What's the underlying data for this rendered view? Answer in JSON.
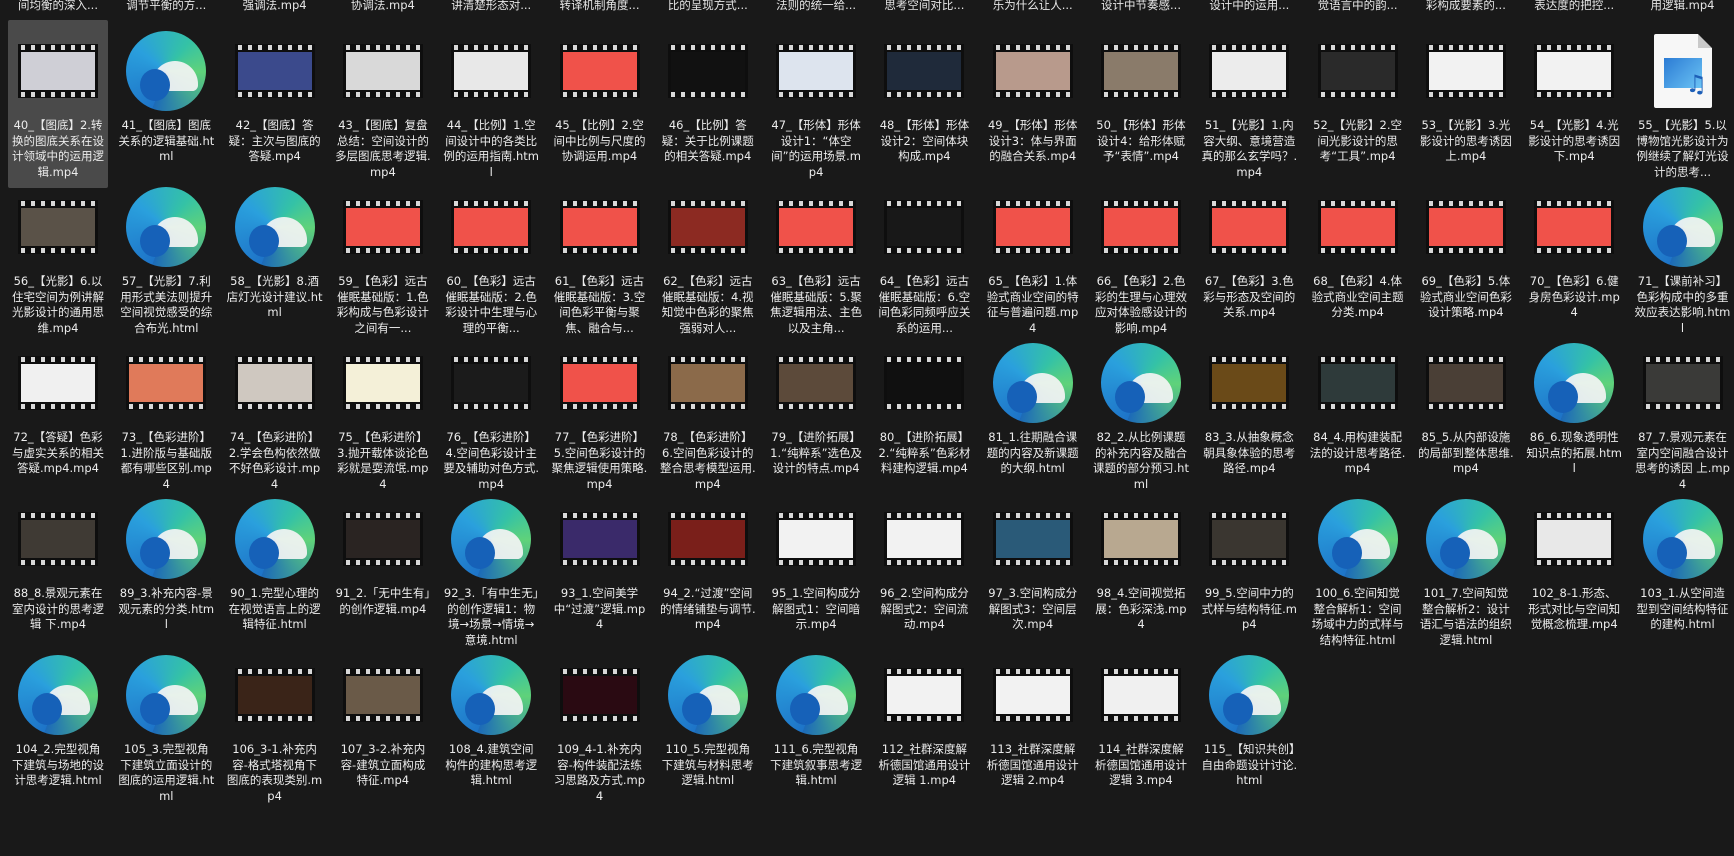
{
  "top_row": [
    "间均衡的深入...",
    "调节平衡的方...",
    "强调法.mp4",
    "协调法.mp4",
    "讲清楚形态对...",
    "转译机制角度...",
    "比的呈现方式...",
    "法则的统一给...",
    "思考空间对比...",
    "乐为什么让人...",
    "设计中节奏感...",
    "设计中的运用...",
    "觉语言中的韵...",
    "彩构成要素的...",
    "表达度的把控...",
    "用逻辑.mp4"
  ],
  "files": [
    {
      "label": "40_【图底】2.转换的图底关系在设计领域中的运用逻辑.mp4",
      "type": "video",
      "thumb": "#cfcfd6",
      "selected": true
    },
    {
      "label": "41_【图底】图底关系的逻辑基础.html",
      "type": "html",
      "thumb": ""
    },
    {
      "label": "42_【图底】答疑：主次与图底的答疑.mp4",
      "type": "video",
      "thumb": "#3b4a8c"
    },
    {
      "label": "43_【图底】复盘总结：空间设计的多层图底思考逻辑.mp4",
      "type": "video",
      "thumb": "#d9d9d9"
    },
    {
      "label": "44_【比例】1.空间设计中的各类比例的运用指南.html",
      "type": "video",
      "thumb": "#e8e8e8"
    },
    {
      "label": "45_【比例】2.空间中比例与尺度的协调运用.mp4",
      "type": "video",
      "thumb": "#f0524a"
    },
    {
      "label": "46_【比例】答疑：关于比例课题的相关答疑.mp4",
      "type": "video",
      "thumb": "#111111"
    },
    {
      "label": "47_【形体】形体设计1：“体空间”的运用场景.mp4",
      "type": "video",
      "thumb": "#dde4ee"
    },
    {
      "label": "48_【形体】形体设计2：空间体块构成.mp4",
      "type": "video",
      "thumb": "#1f2a3a"
    },
    {
      "label": "49_【形体】形体设计3：体与界面的融合关系.mp4",
      "type": "video",
      "thumb": "#b89a8c"
    },
    {
      "label": "50_【形体】形体设计4：给形体赋予“表情”.mp4",
      "type": "video",
      "thumb": "#8a7b6a"
    },
    {
      "label": "51_【光影】1.内容大纲、意境营造真的那么玄学吗？.mp4",
      "type": "video",
      "thumb": "#ececec"
    },
    {
      "label": "52_【光影】2.空间光影设计的思考“工具”.mp4",
      "type": "video",
      "thumb": "#2a2a2a"
    },
    {
      "label": "53_【光影】3.光影设计的思考诱因 上.mp4",
      "type": "video",
      "thumb": "#f2f2f2"
    },
    {
      "label": "54_【光影】4.光影设计的思考诱因 下.mp4",
      "type": "video",
      "thumb": "#f2f2f2"
    },
    {
      "label": "55_【光影】5.以博物馆光影设计为例继续了解灯光设计的思考...",
      "type": "doc",
      "thumb": ""
    },
    {
      "label": "56_【光影】6.以住宅空间为例讲解光影设计的通用思维.mp4",
      "type": "video",
      "thumb": "#5a5248"
    },
    {
      "label": "57_【光影】7.利用形式美法则提升空间视觉感受的综合布光.html",
      "type": "html",
      "thumb": ""
    },
    {
      "label": "58_【光影】8.酒店灯光设计建议.html",
      "type": "html",
      "thumb": ""
    },
    {
      "label": "59_【色彩】远古催眠基础版：1.色彩构成与色彩设计之间有一...",
      "type": "video",
      "thumb": "#f0524a"
    },
    {
      "label": "60_【色彩】远古催眠基础版：2.色彩设计中生理与心理的平衡...",
      "type": "video",
      "thumb": "#f0524a"
    },
    {
      "label": "61_【色彩】远古催眠基础版：3.空间色彩平衡与聚焦、融合与...",
      "type": "video",
      "thumb": "#f0524a"
    },
    {
      "label": "62_【色彩】远古催眠基础版：4.视知觉中色彩的聚焦强弱对人...",
      "type": "video",
      "thumb": "#8c2a22"
    },
    {
      "label": "63_【色彩】远古催眠基础版：5.聚焦逻辑用法、主色以及主角...",
      "type": "video",
      "thumb": "#f0524a"
    },
    {
      "label": "64_【色彩】远古催眠基础版：6.空间色彩同频呼应关系的运用...",
      "type": "video",
      "thumb": "#181818"
    },
    {
      "label": "65_【色彩】1.体验式商业空间的特征与普遍问题.mp4",
      "type": "video",
      "thumb": "#f0524a"
    },
    {
      "label": "66_【色彩】2.色彩的生理与心理效应对体验感设计的影响.mp4",
      "type": "video",
      "thumb": "#f0524a"
    },
    {
      "label": "67_【色彩】3.色彩与形态及空间的关系.mp4",
      "type": "video",
      "thumb": "#f0524a"
    },
    {
      "label": "68_【色彩】4.体验式商业空间主题分类.mp4",
      "type": "video",
      "thumb": "#f0524a"
    },
    {
      "label": "69_【色彩】5.体验式商业空间色彩设计策略.mp4",
      "type": "video",
      "thumb": "#f0524a"
    },
    {
      "label": "70_【色彩】6.健身房色彩设计.mp4",
      "type": "video",
      "thumb": "#f0524a"
    },
    {
      "label": "71_【课前补习】色彩构成中的多重效应表达影响.html",
      "type": "html",
      "thumb": ""
    },
    {
      "label": "72_【答疑】色彩与虚实关系的相关答疑.mp4.mp4",
      "type": "video",
      "thumb": "#f0f0f0"
    },
    {
      "label": "73_【色彩进阶】1.进阶版与基础版都有哪些区别.mp4",
      "type": "video",
      "thumb": "#e07a5a"
    },
    {
      "label": "74_【色彩进阶】2.学会色构依然做不好色彩设计.mp4",
      "type": "video",
      "thumb": "#cfc8c0"
    },
    {
      "label": "75_【色彩进阶】3.抛开载体谈论色彩就是耍流氓.mp4",
      "type": "video",
      "thumb": "#f4f0d8"
    },
    {
      "label": "76_【色彩进阶】4.空间色彩设计主要及辅助对色方式.mp4",
      "type": "video",
      "thumb": "#1b1b1b"
    },
    {
      "label": "77_【色彩进阶】5.空间色彩设计的聚焦逻辑使用策略.mp4",
      "type": "video",
      "thumb": "#f0524a"
    },
    {
      "label": "78_【色彩进阶】6.空间色彩设计的整合思考模型运用.mp4",
      "type": "video",
      "thumb": "#8b6a4a"
    },
    {
      "label": "79_【进阶拓展】1.“纯粹系”选色及设计的特点.mp4",
      "type": "video",
      "thumb": "#5c4a3a"
    },
    {
      "label": "80_【进阶拓展】2.“纯粹系”色彩材料建构逻辑.mp4",
      "type": "video",
      "thumb": "#101010"
    },
    {
      "label": "81_1.往期融合课题的内容及新课题的大纲.html",
      "type": "html",
      "thumb": ""
    },
    {
      "label": "82_2.从比例课题的补充内容及融合课题的部分预习.html",
      "type": "html",
      "thumb": ""
    },
    {
      "label": "83_3.从抽象概念朝具象体验的思考路径.mp4",
      "type": "video",
      "thumb": "#6a4a18"
    },
    {
      "label": "84_4.用构建装配法的设计思考路径.mp4",
      "type": "video",
      "thumb": "#2e3a3a"
    },
    {
      "label": "85_5.从内部设施的局部到整体思维.mp4",
      "type": "video",
      "thumb": "#4a3f36"
    },
    {
      "label": "86_6.现象透明性知识点的拓展.html",
      "type": "html",
      "thumb": ""
    },
    {
      "label": "87_7.景观元素在室内空间融合设计思考的诱因 上.mp4",
      "type": "video",
      "thumb": "#3a3a38"
    },
    {
      "label": "88_8.景观元素在室内设计的思考逻辑 下.mp4",
      "type": "video",
      "thumb": "#3f3a34"
    },
    {
      "label": "89_3.补充内容-景观元素的分类.html",
      "type": "html",
      "thumb": ""
    },
    {
      "label": "90_1.完型心理的在视觉语言上的逻辑特征.html",
      "type": "html",
      "thumb": ""
    },
    {
      "label": "91_2.「无中生有」的创作逻辑.mp4",
      "type": "video",
      "thumb": "#2a2422"
    },
    {
      "label": "92_3.「有中生无」的创作逻辑1：物境→场景→情境→意境.html",
      "type": "html",
      "thumb": ""
    },
    {
      "label": "93_1.空间美学中“过渡”逻辑.mp4",
      "type": "video",
      "thumb": "#3a2a6a"
    },
    {
      "label": "94_2.“过渡”空间的情绪铺垫与调节.mp4",
      "type": "video",
      "thumb": "#7a1f1a"
    },
    {
      "label": "95_1.空间构成分解图式1：空间暗示.mp4",
      "type": "video",
      "thumb": "#f2f2f2"
    },
    {
      "label": "96_2.空间构成分解图式2：空间流动.mp4",
      "type": "video",
      "thumb": "#f2f2f2"
    },
    {
      "label": "97_3.空间构成分解图式3：空间层次.mp4",
      "type": "video",
      "thumb": "#2a5a78"
    },
    {
      "label": "98_4.空间视觉拓展：色彩深浅.mp4",
      "type": "video",
      "thumb": "#b8a890"
    },
    {
      "label": "99_5.空间中力的式样与结构特征.mp4",
      "type": "video",
      "thumb": "#3a3630"
    },
    {
      "label": "100_6.空间知觉整合解析1：空间场域中力的式样与结构特征.html",
      "type": "html",
      "thumb": ""
    },
    {
      "label": "101_7.空间知觉整合解析2：设计语汇与语法的组织逻辑.html",
      "type": "html",
      "thumb": ""
    },
    {
      "label": "102_8-1.形态、形式对比与空间知觉概念梳理.mp4",
      "type": "video",
      "thumb": "#e8e8e8"
    },
    {
      "label": "103_1.从空间造型到空间结构特征的建构.html",
      "type": "html",
      "thumb": ""
    },
    {
      "label": "104_2.完型视角下建筑与场地的设计思考逻辑.html",
      "type": "html",
      "thumb": ""
    },
    {
      "label": "105_3.完型视角下建筑立面设计的图底的运用逻辑.html",
      "type": "html",
      "thumb": ""
    },
    {
      "label": "106_3-1.补充内容-格式塔视角下图底的表现类别.mp4",
      "type": "video",
      "thumb": "#3a2418"
    },
    {
      "label": "107_3-2.补充内容-建筑立面构成特征.mp4",
      "type": "video",
      "thumb": "#6a5a48"
    },
    {
      "label": "108_4.建筑空间构件的建构思考逻辑.html",
      "type": "html",
      "thumb": ""
    },
    {
      "label": "109_4-1.补充内容-构件装配法练习思路及方式.mp4",
      "type": "video",
      "thumb": "#2a0a12"
    },
    {
      "label": "110_5.完型视角下建筑与材料思考逻辑.html",
      "type": "html",
      "thumb": ""
    },
    {
      "label": "111_6.完型视角下建筑叙事思考逻辑.html",
      "type": "html",
      "thumb": ""
    },
    {
      "label": "112_社群深度解析德国馆通用设计逻辑 1.mp4",
      "type": "video",
      "thumb": "#f2f2f2"
    },
    {
      "label": "113_社群深度解析德国馆通用设计逻辑 2.mp4",
      "type": "video",
      "thumb": "#f2f2f2"
    },
    {
      "label": "114_社群深度解析德国馆通用设计逻辑 3.mp4",
      "type": "video",
      "thumb": "#f0f0f0"
    },
    {
      "label": "115_【知识共创】自由命题设计讨论.html",
      "type": "html",
      "thumb": ""
    }
  ]
}
